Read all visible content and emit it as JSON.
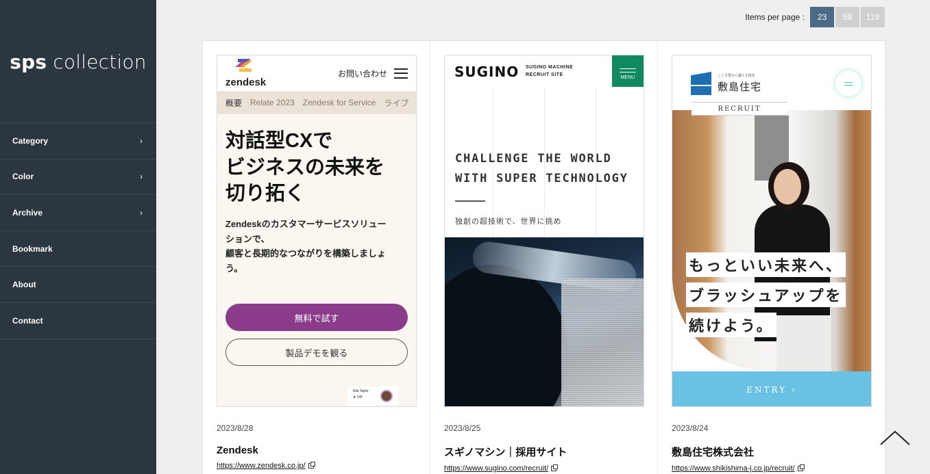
{
  "sidebar": {
    "logo_bold": "sps",
    "logo_rest": " collection",
    "items": [
      {
        "label": "Category",
        "has_chevron": true
      },
      {
        "label": "Color",
        "has_chevron": true
      },
      {
        "label": "Archive",
        "has_chevron": true
      },
      {
        "label": "Bookmark",
        "has_chevron": false
      },
      {
        "label": "About",
        "has_chevron": false
      },
      {
        "label": "Contact",
        "has_chevron": false
      }
    ],
    "chevron_glyph": "›",
    "bg_color": "#2b3640"
  },
  "pager": {
    "label": "Items per page :",
    "options": [
      "23",
      "59",
      "119"
    ],
    "active": "23"
  },
  "cards": [
    {
      "date": "2023/8/28",
      "title": "Zendesk",
      "url": "https://www.zendesk.co.jp/",
      "shot": {
        "logo": "zendesk",
        "nav_link": "お問い合わせ",
        "tabs": [
          "概要",
          "Relate 2023",
          "Zendesk for Service",
          "ライブ"
        ],
        "headline": "対話型CXで\nビジネスの未来を\n切り拓く",
        "body": "Zendeskのカスタマーサービスソリュー\nションで、\n顧客と長期的なつながりを構築しましょ\nう。",
        "btn_primary": "無料で試す",
        "btn_secondary": "製品デモを観る",
        "chip_name": "Ella Taylor",
        "chip_tag": "VIP"
      }
    },
    {
      "date": "2023/8/25",
      "title": "スギノマシン｜採用サイト",
      "url": "https://www.sugino.com/recruit/",
      "shot": {
        "logo": "SUGINO",
        "sub": "SUGINO MACHINE\nRECRUIT SITE",
        "menu": "MENU",
        "headline": "CHALLENGE THE WORLD\nWITH SUPER TECHNOLOGY",
        "tagline": "独創の超技術で、世界に挑め"
      }
    },
    {
      "date": "2023/8/24",
      "title": "敷島住宅株式会社",
      "url": "https://www.shikishima-j.co.jp/recruit/",
      "shot": {
        "logo_small": "こころ豊かに暮らす街を",
        "logo": "敷島住宅",
        "recruit": "RECRUIT",
        "copy": [
          "もっといい未来へ、",
          "ブラッシュアップを",
          "続けよう。"
        ],
        "entry": "ENTRY ›"
      }
    }
  ],
  "icons": {
    "back_to_top": "chevron-up-icon",
    "external_link": "external-link-icon"
  }
}
